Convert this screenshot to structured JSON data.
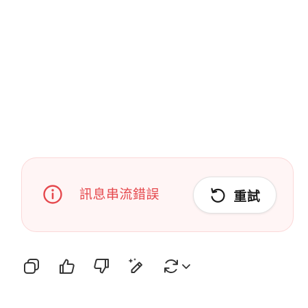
{
  "error": {
    "message": "訊息串流錯誤",
    "icon": "info-icon",
    "retry_label": "重試",
    "retry_icon": "retry-icon",
    "accent_color": "#e5484d",
    "background_color": "#fff5f5"
  },
  "actions": [
    {
      "name": "copy",
      "icon": "copy-icon"
    },
    {
      "name": "thumbs-up",
      "icon": "thumbs-up-icon"
    },
    {
      "name": "thumbs-down",
      "icon": "thumbs-down-icon"
    },
    {
      "name": "edit-sparkle",
      "icon": "magic-pen-icon"
    },
    {
      "name": "regenerate",
      "icon": "refresh-icon"
    }
  ]
}
